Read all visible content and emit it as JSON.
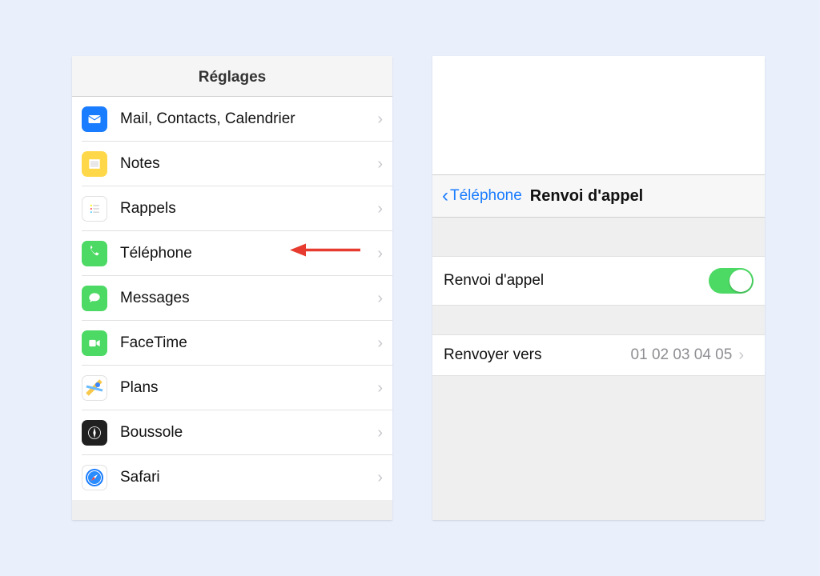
{
  "left": {
    "title": "Réglages",
    "items": [
      {
        "label": "Mail, Contacts, Calendrier",
        "icon": "mail",
        "bg": "#1a7cff"
      },
      {
        "label": "Notes",
        "icon": "notes",
        "bg": "#ffd84a"
      },
      {
        "label": "Rappels",
        "icon": "reminders",
        "bg": "#ffffff"
      },
      {
        "label": "Téléphone",
        "icon": "phone",
        "bg": "#4cd964"
      },
      {
        "label": "Messages",
        "icon": "messages",
        "bg": "#4cd964"
      },
      {
        "label": "FaceTime",
        "icon": "facetime",
        "bg": "#4cd964"
      },
      {
        "label": "Plans",
        "icon": "maps",
        "bg": "#ffffff"
      },
      {
        "label": "Boussole",
        "icon": "compass",
        "bg": "#202020"
      },
      {
        "label": "Safari",
        "icon": "safari",
        "bg": "#ffffff"
      }
    ],
    "highlighted_index": 3
  },
  "right": {
    "back_label": "Téléphone",
    "title": "Renvoi d'appel",
    "toggle_label": "Renvoi d'appel",
    "toggle_on": true,
    "forward_label": "Renvoyer vers",
    "forward_value": "01 02 03 04 05"
  },
  "colors": {
    "accent_blue": "#1a7cff",
    "toggle_green": "#4cd964",
    "arrow_red": "#e63b2e"
  }
}
